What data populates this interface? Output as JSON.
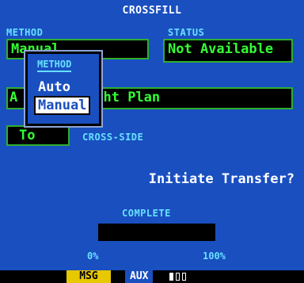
{
  "title": "CROSSFILL",
  "method": {
    "label": "METHOD",
    "value": "Manual"
  },
  "status": {
    "label": "STATUS",
    "value": "Not Available"
  },
  "plan_field": {
    "value_left": "A",
    "value_right": "ght Plan"
  },
  "direction": {
    "value": "To",
    "label": "CROSS-SIDE"
  },
  "popup": {
    "title": "METHOD",
    "options": [
      "Auto",
      "Manual"
    ],
    "selected": "Manual"
  },
  "action": {
    "label": "Initiate Transfer?"
  },
  "progress": {
    "label": "COMPLETE",
    "min_label": "0%",
    "max_label": "100%",
    "value": 0
  },
  "statusbar": {
    "msg": "MSG",
    "aux": "AUX",
    "page_indicator_active": 1,
    "page_indicator_total": 3
  },
  "colors": {
    "background": "#1a4fc0",
    "field_border": "#2fae2f",
    "field_text": "#33ff33",
    "label": "#66e0ff",
    "msg": "#e8c800"
  }
}
